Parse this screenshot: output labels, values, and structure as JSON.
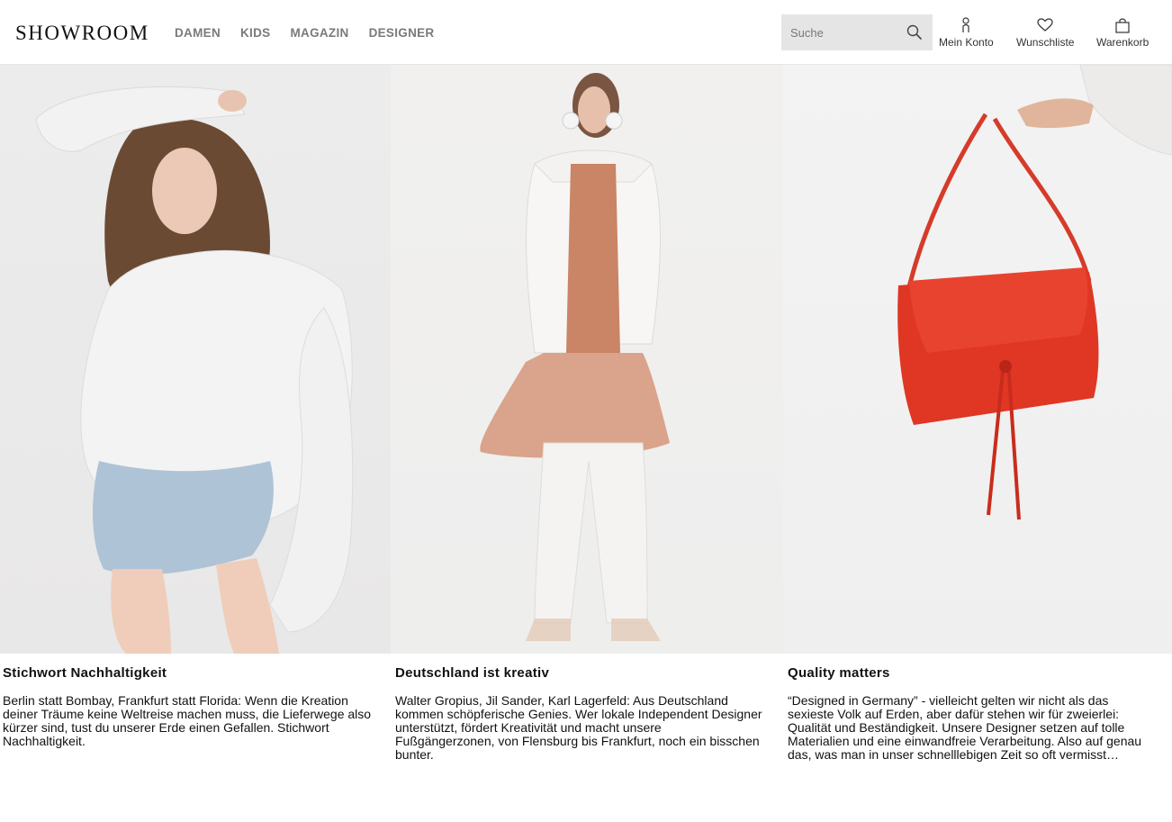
{
  "header": {
    "logo": "SHOWROOM",
    "nav": [
      "DAMEN",
      "KIDS",
      "MAGAZIN",
      "DESIGNER"
    ],
    "search_placeholder": "Suche",
    "account_label": "Mein Konto",
    "wishlist_label": "Wunschliste",
    "cart_label": "Warenkorb",
    "icons": {
      "search": "search-icon",
      "account": "person-icon",
      "wishlist": "heart-icon",
      "cart": "shopping-bag-icon"
    }
  },
  "cards": [
    {
      "title": "Stichwort Nachhaltigkeit",
      "text": "Berlin statt Bombay, Frankfurt statt Florida: Wenn die Kreation deiner Träume keine Weltreise machen muss, die Lieferwege also kürzer sind, tust du unserer Erde einen Gefallen. Stichwort Nachhaltigkeit."
    },
    {
      "title": "Deutschland ist kreativ",
      "text": "Walter Gropius, Jil Sander, Karl Lagerfeld: Aus Deutschland kommen schöpferische Genies. Wer lokale Independent Designer unterstützt, fördert Kreativität und macht unsere Fußgängerzonen, von Flensburg bis Frankfurt, noch ein bisschen bunter."
    },
    {
      "title": "Quality matters",
      "text": "“Designed in Germany” - vielleicht gelten wir nicht als das sexieste Volk auf Erden, aber dafür stehen wir für zweierlei: Qualität und Beständigkeit. Unsere Designer setzen auf tolle Materialien und eine einwandfreie Verarbeitung. Also auf genau das, was man in unser schnelllebigen Zeit so oft vermisst…"
    }
  ]
}
